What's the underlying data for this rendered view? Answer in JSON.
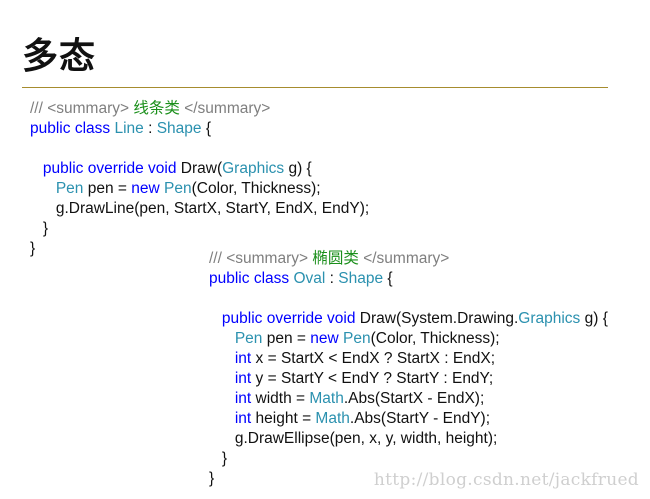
{
  "slide": {
    "title": "多态"
  },
  "code_blocks": [
    {
      "name": "line-class",
      "lines": [
        [
          [
            "comment",
            "/// <summary> "
          ],
          [
            "cn",
            "线条类"
          ],
          [
            "comment",
            " </summary>"
          ]
        ],
        [
          [
            "kw",
            "public"
          ],
          [
            "plain",
            " "
          ],
          [
            "kw",
            "class"
          ],
          [
            "plain",
            " "
          ],
          [
            "type",
            "Line"
          ],
          [
            "plain",
            " : "
          ],
          [
            "type",
            "Shape"
          ],
          [
            "plain",
            " {"
          ]
        ],
        [],
        [
          [
            "plain",
            "   "
          ],
          [
            "kw",
            "public"
          ],
          [
            "plain",
            " "
          ],
          [
            "kw",
            "override"
          ],
          [
            "plain",
            " "
          ],
          [
            "kw",
            "void"
          ],
          [
            "plain",
            " Draw("
          ],
          [
            "type",
            "Graphics"
          ],
          [
            "plain",
            " g) {"
          ]
        ],
        [
          [
            "plain",
            "      "
          ],
          [
            "type",
            "Pen"
          ],
          [
            "plain",
            " pen = "
          ],
          [
            "kw",
            "new"
          ],
          [
            "plain",
            " "
          ],
          [
            "type",
            "Pen"
          ],
          [
            "plain",
            "(Color, Thickness);"
          ]
        ],
        [
          [
            "plain",
            "      g.DrawLine(pen, StartX, StartY, EndX, EndY);"
          ]
        ],
        [
          [
            "plain",
            "   }"
          ]
        ],
        [
          [
            "plain",
            "}"
          ]
        ]
      ]
    },
    {
      "name": "oval-class",
      "lines": [
        [
          [
            "comment",
            "/// <summary> "
          ],
          [
            "cn",
            "椭圆类"
          ],
          [
            "comment",
            " </summary>"
          ]
        ],
        [
          [
            "kw",
            "public"
          ],
          [
            "plain",
            " "
          ],
          [
            "kw",
            "class"
          ],
          [
            "plain",
            " "
          ],
          [
            "type",
            "Oval"
          ],
          [
            "plain",
            " : "
          ],
          [
            "type",
            "Shape"
          ],
          [
            "plain",
            " {"
          ]
        ],
        [],
        [
          [
            "plain",
            "   "
          ],
          [
            "kw",
            "public"
          ],
          [
            "plain",
            " "
          ],
          [
            "kw",
            "override"
          ],
          [
            "plain",
            " "
          ],
          [
            "kw",
            "void"
          ],
          [
            "plain",
            " Draw(System.Drawing."
          ],
          [
            "type",
            "Graphics"
          ],
          [
            "plain",
            " g) {"
          ]
        ],
        [
          [
            "plain",
            "      "
          ],
          [
            "type",
            "Pen"
          ],
          [
            "plain",
            " pen = "
          ],
          [
            "kw",
            "new"
          ],
          [
            "plain",
            " "
          ],
          [
            "type",
            "Pen"
          ],
          [
            "plain",
            "(Color, Thickness);"
          ]
        ],
        [
          [
            "plain",
            "      "
          ],
          [
            "kw",
            "int"
          ],
          [
            "plain",
            " x = StartX < EndX ? StartX : EndX;"
          ]
        ],
        [
          [
            "plain",
            "      "
          ],
          [
            "kw",
            "int"
          ],
          [
            "plain",
            " y = StartY < EndY ? StartY : EndY;"
          ]
        ],
        [
          [
            "plain",
            "      "
          ],
          [
            "kw",
            "int"
          ],
          [
            "plain",
            " width = "
          ],
          [
            "type",
            "Math"
          ],
          [
            "plain",
            ".Abs(StartX - EndX);"
          ]
        ],
        [
          [
            "plain",
            "      "
          ],
          [
            "kw",
            "int"
          ],
          [
            "plain",
            " height = "
          ],
          [
            "type",
            "Math"
          ],
          [
            "plain",
            ".Abs(StartY - EndY);"
          ]
        ],
        [
          [
            "plain",
            "      g.DrawEllipse(pen, x, y, width, height);"
          ]
        ],
        [
          [
            "plain",
            "   }"
          ]
        ],
        [
          [
            "plain",
            "}"
          ]
        ]
      ]
    }
  ],
  "watermark": "http://blog.csdn.net/jackfrued"
}
